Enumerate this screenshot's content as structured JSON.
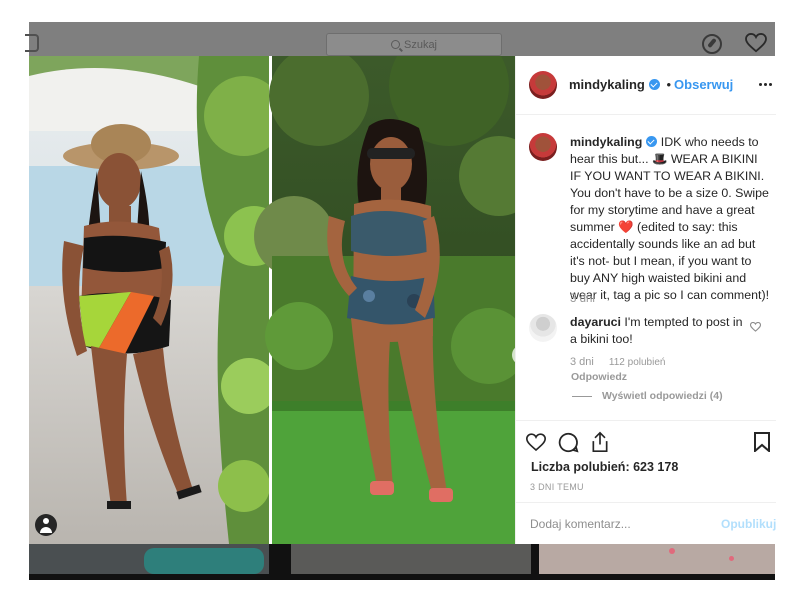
{
  "topbar": {
    "search_placeholder": "Szukaj"
  },
  "post": {
    "username": "mindykaling",
    "follow_label": "Obserwuj",
    "follow_separator": "•",
    "caption": "IDK who needs to hear this but... 🎩 WEAR A BIKINI IF YOU WANT TO WEAR A BIKINI. You don't have to be a size 0. Swipe for my storytime and have a great summer ❤️ (edited to say: this accidentally sounds like an ad but it's not- but I mean, if you want to buy ANY high waisted bikini and wear it, tag a pic so I can comment)!",
    "caption_age": "3 dni",
    "likes_text": "Liczba polubień: 623 178",
    "posted_ago": "3 DNI TEMU"
  },
  "comment": {
    "username": "dayaruci",
    "text": "I'm tempted to post in a bikini too!",
    "age": "3 dni",
    "likes": "112 polubień",
    "reply_label": "Odpowiedz",
    "view_replies": "Wyświetl odpowiedzi (4)"
  },
  "composer": {
    "placeholder": "Dodaj komentarz...",
    "publish_label": "Opublikuj"
  },
  "colors": {
    "accent": "#3897f0",
    "publish_disabled": "#b2dffc",
    "heart": "#ed4956"
  },
  "icons": [
    "instagram-logo-icon",
    "search-icon",
    "compass-icon",
    "heart-icon",
    "more-icon",
    "verified-icon",
    "chevron-right-icon",
    "user-tag-icon",
    "comment-icon",
    "share-icon",
    "bookmark-icon"
  ]
}
